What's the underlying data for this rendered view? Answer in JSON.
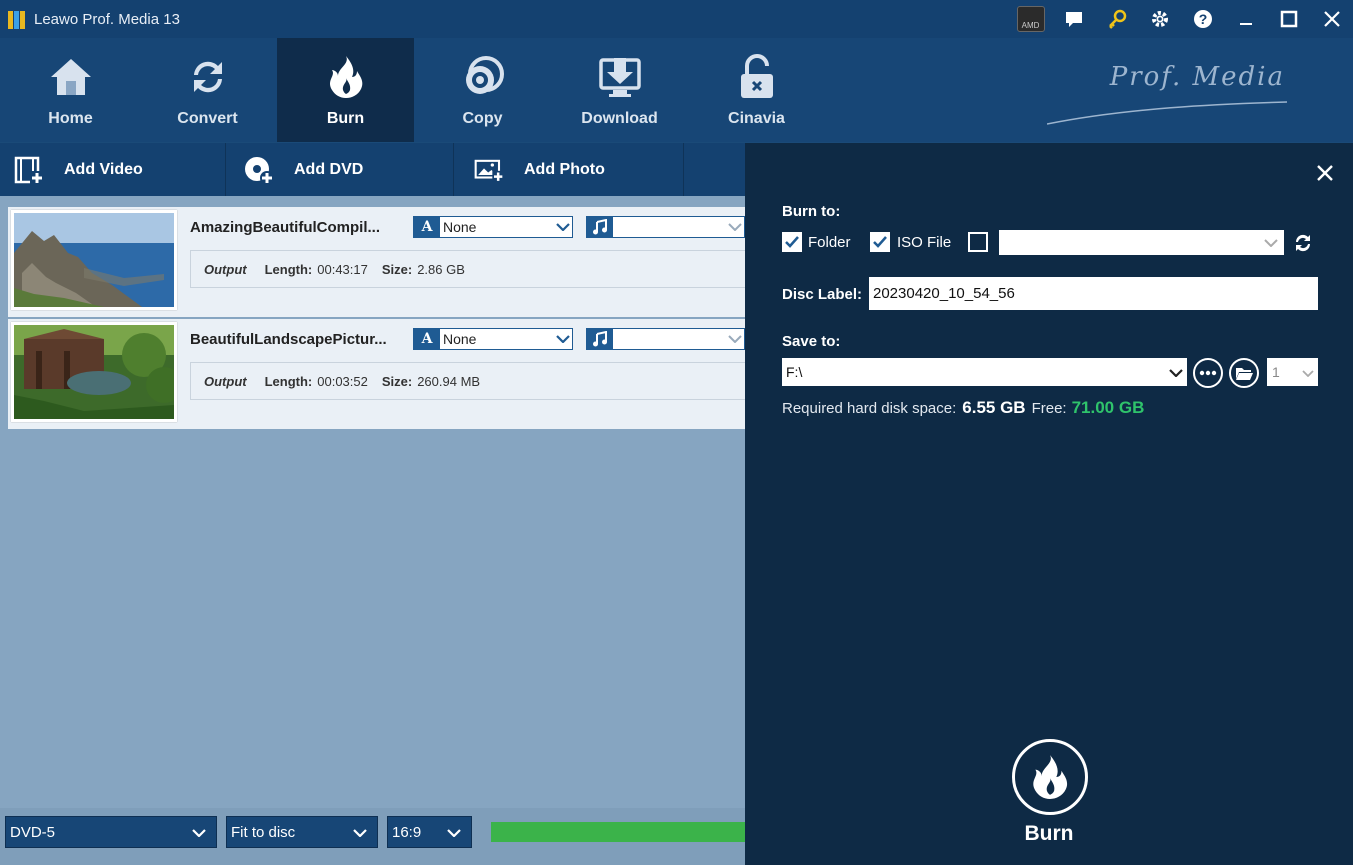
{
  "app": {
    "title": "Leawo Prof. Media 13",
    "brand": "Prof. Media"
  },
  "window_controls": {
    "amd_badge": "AMD"
  },
  "nav": {
    "items": [
      {
        "label": "Home",
        "icon": "home-icon"
      },
      {
        "label": "Convert",
        "icon": "convert-icon"
      },
      {
        "label": "Burn",
        "icon": "burn-flame-icon",
        "active": true
      },
      {
        "label": "Copy",
        "icon": "copy-disc-icon"
      },
      {
        "label": "Download",
        "icon": "download-icon"
      },
      {
        "label": "Cinavia",
        "icon": "cinavia-lock-icon"
      }
    ]
  },
  "toolbar": {
    "add_video": "Add Video",
    "add_dvd": "Add DVD",
    "add_photo": "Add Photo"
  },
  "videos": [
    {
      "title": "AmazingBeautifulCompil...",
      "subtitle": "None",
      "output_label": "Output",
      "length_label": "Length:",
      "length": "00:43:17",
      "size_label": "Size:",
      "size": "2.86 GB"
    },
    {
      "title": "BeautifulLandscapePictur...",
      "subtitle": "None",
      "output_label": "Output",
      "length_label": "Length:",
      "length": "00:03:52",
      "size_label": "Size:",
      "size": "260.94 MB"
    }
  ],
  "bottom": {
    "disc_type": "DVD-5",
    "fit_mode": "Fit to disc",
    "aspect": "16:9",
    "progress_percent": 100
  },
  "panel": {
    "burn_to_label": "Burn to:",
    "folder_label": "Folder",
    "folder_checked": true,
    "iso_label": "ISO File",
    "iso_checked": true,
    "disc_checked": false,
    "disc_label_label": "Disc Label:",
    "disc_label_value": "20230420_10_54_56",
    "save_to_label": "Save to:",
    "save_to_value": "F:\\",
    "copies": "1",
    "space_prefix": "Required hard disk space:",
    "required_space": "6.55 GB",
    "free_label": "Free:",
    "free_space": "71.00 GB",
    "burn_button": "Burn"
  },
  "colors": {
    "titlebar": "#144170",
    "nav_active": "#0f2c4b",
    "panel_bg": "#0e2a45",
    "list_bg": "#86a5c1",
    "free_space_green": "#2fc36b",
    "progress_green": "#3bb34a"
  }
}
